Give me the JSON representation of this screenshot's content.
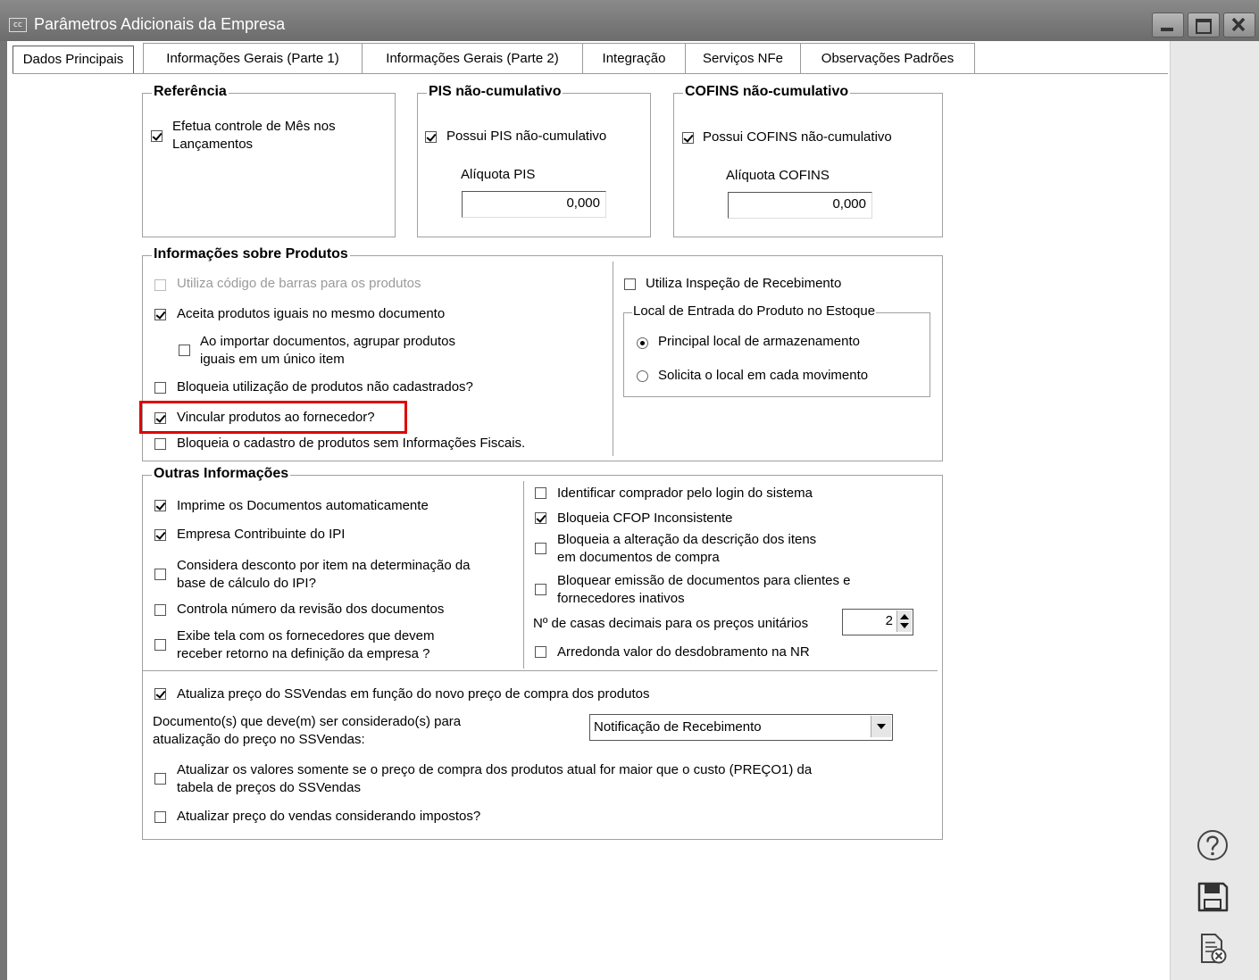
{
  "window": {
    "title": "Parâmetros Adicionais da Empresa",
    "logo": "cc"
  },
  "tabs": [
    {
      "label": "Dados Principais",
      "active": true
    },
    {
      "label": "Informações Gerais (Parte 1)",
      "active": false
    },
    {
      "label": "Informações Gerais (Parte 2)",
      "active": false
    },
    {
      "label": "Integração",
      "active": false
    },
    {
      "label": "Serviços NFe",
      "active": false
    },
    {
      "label": "Observações Padrões",
      "active": false
    }
  ],
  "referencia": {
    "title": "Referência",
    "controle_mes_line1": "Efetua controle de Mês nos",
    "controle_mes_line2": "Lançamentos",
    "controle_mes_checked": true
  },
  "pis": {
    "title": "PIS não-cumulativo",
    "possui_label": "Possui PIS não-cumulativo",
    "possui_checked": true,
    "aliquota_label": "Alíquota PIS",
    "aliquota_value": "0,000"
  },
  "cofins": {
    "title": "COFINS não-cumulativo",
    "possui_label": "Possui COFINS não-cumulativo",
    "possui_checked": true,
    "aliquota_label": "Alíquota COFINS",
    "aliquota_value": "0,000"
  },
  "produtos": {
    "title": "Informações sobre Produtos",
    "codigo_barras": "Utiliza código de barras para os produtos",
    "aceita_iguais": "Aceita produtos iguais no mesmo documento",
    "agrupar_line1": "Ao importar documentos, agrupar produtos",
    "agrupar_line2": "iguais em um único item",
    "bloqueia_nao_cadastrados": "Bloqueia utilização de produtos não cadastrados?",
    "vincular_fornecedor": "Vincular produtos ao fornecedor?",
    "bloqueia_sem_fiscais": "Bloqueia o cadastro de produtos sem Informações Fiscais.",
    "inspecao": "Utiliza Inspeção de Recebimento",
    "local_title": "Local de Entrada do Produto no Estoque",
    "local_principal": "Principal local de armazenamento",
    "local_solicita": "Solicita o local em cada movimento"
  },
  "outras": {
    "title": "Outras Informações",
    "imprime": "Imprime os Documentos automaticamente",
    "contribuinte_ipi": "Empresa Contribuinte do IPI",
    "desconto_line1": "Considera desconto por item na determinação da",
    "desconto_line2": "base de cálculo do IPI?",
    "revisao": "Controla número da revisão dos documentos",
    "exibe_line1": "Exibe tela com os fornecedores que devem",
    "exibe_line2": "receber retorno na definição da empresa ?",
    "identificar": "Identificar comprador pelo login do sistema",
    "cfop": "Bloqueia CFOP Inconsistente",
    "alteracao_line1": "Bloqueia a alteração da descrição dos itens",
    "alteracao_line2": "em documentos de compra",
    "emissao_line1": "Bloquear emissão de documentos para clientes e",
    "emissao_line2": "fornecedores inativos",
    "casas_label": "Nº de casas decimais para os preços unitários",
    "casas_value": "2",
    "arredonda": "Arredonda valor do desdobramento na NR"
  },
  "ssvendas": {
    "atualiza": "Atualiza preço do SSVendas em função do novo preço de compra dos produtos",
    "documentos_line1": "Documento(s) que deve(m) ser considerado(s) para",
    "documentos_line2": "atualização do preço no SSVendas:",
    "documentos_value": "Notificação de Recebimento",
    "somente_line1": "Atualizar os valores somente se o preço de compra dos produtos atual for maior que o custo (PREÇO1) da",
    "somente_line2": "tabela de preços do SSVendas",
    "impostos": "Atualizar preço do vendas considerando impostos?"
  },
  "side_icons": [
    "help-icon",
    "save-icon",
    "close-document-icon"
  ],
  "colors": {
    "highlight": "#e00000",
    "titlebar": "#7a7a7a"
  }
}
